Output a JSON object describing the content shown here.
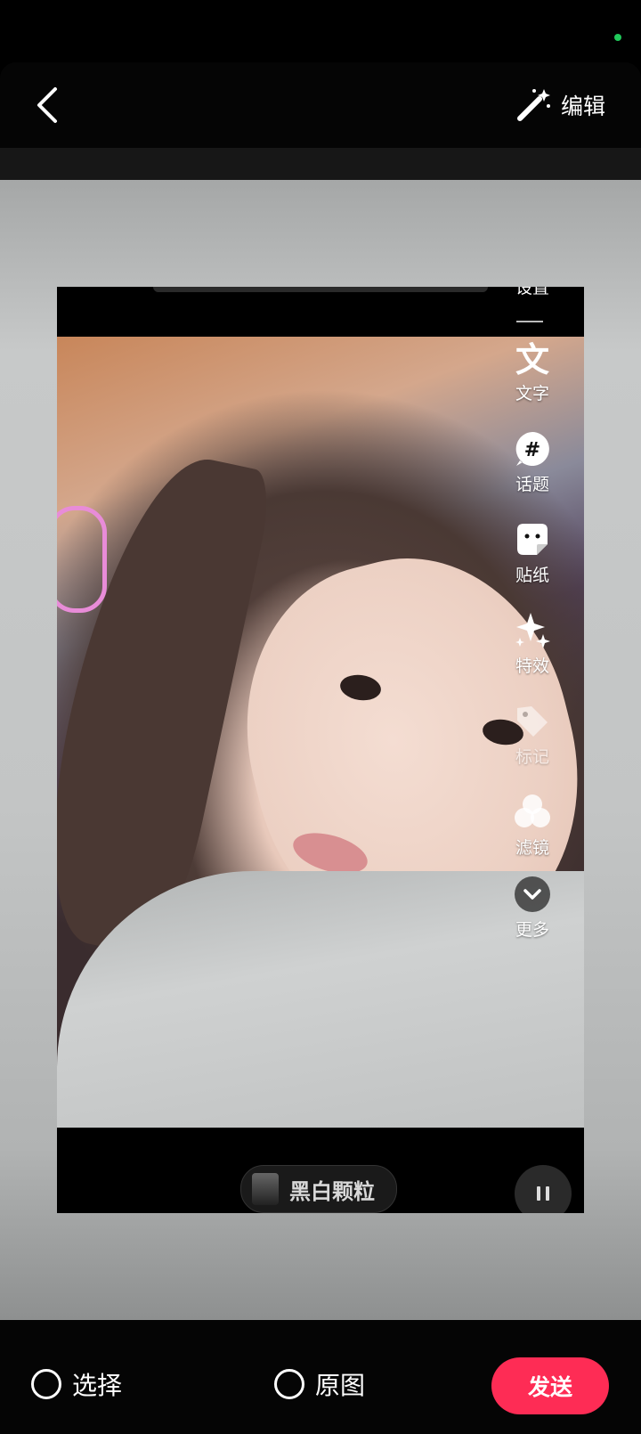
{
  "header": {
    "edit_label": "编辑"
  },
  "preview": {
    "tools": {
      "settings_label": "设置",
      "items": [
        {
          "label": "文字",
          "icon": "text-icon"
        },
        {
          "label": "话题",
          "icon": "hashtag-icon"
        },
        {
          "label": "贴纸",
          "icon": "sticker-icon"
        },
        {
          "label": "特效",
          "icon": "sparkle-effects-icon"
        },
        {
          "label": "标记",
          "icon": "tag-icon"
        },
        {
          "label": "滤镜",
          "icon": "filter-icon"
        },
        {
          "label": "更多",
          "icon": "chevron-down-icon"
        }
      ]
    },
    "filter_name": "黑白颗粒"
  },
  "footer": {
    "select_label": "选择",
    "original_label": "原图",
    "send_label": "发送"
  },
  "colors": {
    "accent": "#fe2c55",
    "status_dot": "#20c95a"
  }
}
